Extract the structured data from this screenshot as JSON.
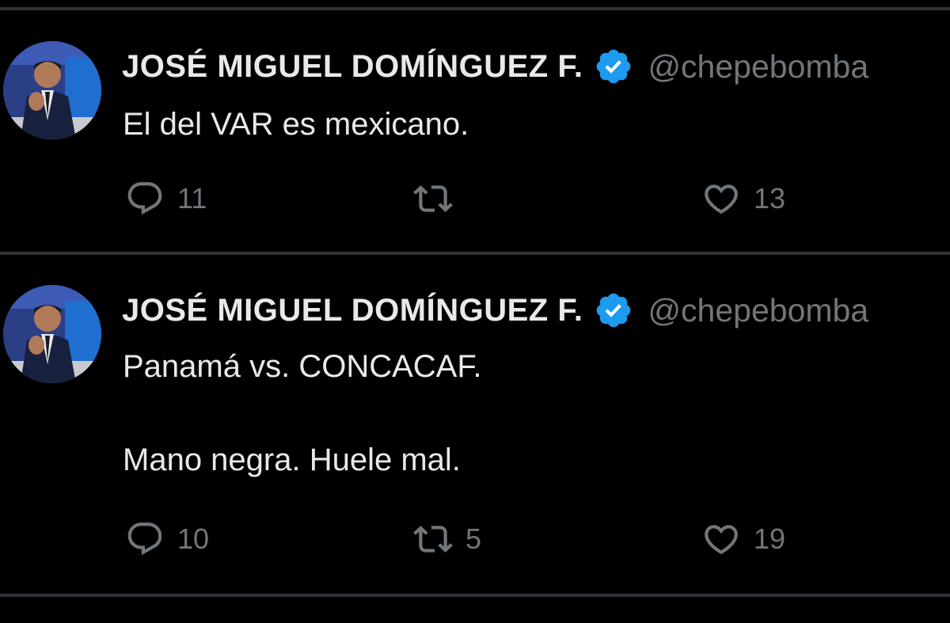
{
  "tweets": [
    {
      "author": {
        "name": "JOSÉ MIGUEL DOMÍNGUEZ F.",
        "handle": "@chepebomba",
        "verified": true,
        "avatar": "profile-photo"
      },
      "text_lines": [
        "El del VAR es mexicano."
      ],
      "actions": {
        "replies": "11",
        "retweets": "",
        "likes": "13"
      }
    },
    {
      "author": {
        "name": "JOSÉ MIGUEL DOMÍNGUEZ F.",
        "handle": "@chepebomba",
        "verified": true,
        "avatar": "profile-photo"
      },
      "text_lines": [
        "Panamá vs. CONCACAF.",
        "",
        "Mano negra. Huele mal."
      ],
      "actions": {
        "replies": "10",
        "retweets": "5",
        "likes": "19"
      }
    }
  ],
  "icons": {
    "reply": "reply-icon",
    "retweet": "retweet-icon",
    "like": "heart-icon",
    "verified": "verified-badge-icon"
  },
  "colors": {
    "background": "#000000",
    "text": "#e7e9ea",
    "muted": "#71767b",
    "divider": "#2f3336",
    "verified": "#1d9bf0"
  }
}
